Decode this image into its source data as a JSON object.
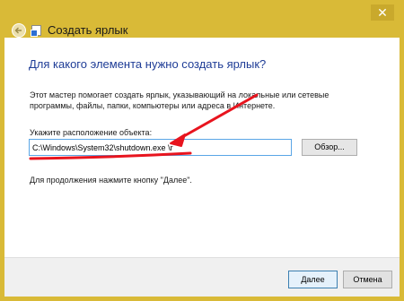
{
  "window": {
    "title": "Создать ярлык",
    "close_glyph": "✕"
  },
  "main": {
    "heading": "Для какого элемента нужно создать ярлык?",
    "description": "Этот мастер помогает создать ярлык, указывающий на локальные или сетевые программы, файлы, папки, компьютеры или адреса в Интернете.",
    "location_label": "Укажите расположение объекта:",
    "location_value": "C:\\Windows\\System32\\shutdown.exe \\r",
    "browse_label": "Обзор...",
    "hint": "Для продолжения нажмите кнопку \"Далее\"."
  },
  "footer": {
    "next_label": "Далее",
    "cancel_label": "Отмена"
  },
  "colors": {
    "frame": "#d9ba37",
    "heading": "#1e3c96",
    "annotation": "#e8141e",
    "input_border": "#5aa6e6"
  },
  "icons": {
    "back": "back-arrow-icon",
    "title": "shortcut-icon",
    "close": "close-icon"
  }
}
